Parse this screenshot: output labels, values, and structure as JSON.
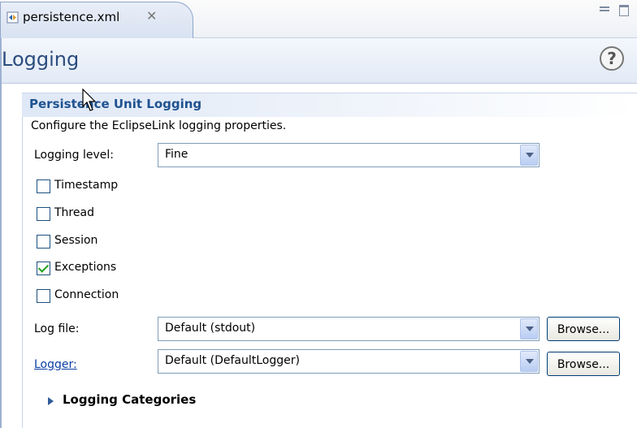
{
  "tab": {
    "title": "persistence.xml",
    "close_glyph": "✕"
  },
  "header": {
    "title": "Logging",
    "help_glyph": "?"
  },
  "section": {
    "title": "Persistence Unit Logging",
    "description": "Configure the EclipseLink logging properties."
  },
  "logging_level": {
    "label": "Logging level:",
    "value": "Fine"
  },
  "checkboxes": [
    {
      "label": "Timestamp",
      "checked": false
    },
    {
      "label": "Thread",
      "checked": false
    },
    {
      "label": "Session",
      "checked": false
    },
    {
      "label": "Exceptions",
      "checked": true
    },
    {
      "label": "Connection",
      "checked": false
    }
  ],
  "log_file": {
    "label": "Log file:",
    "value": "Default (stdout)",
    "browse": "Browse..."
  },
  "logger": {
    "label": "Logger:",
    "value": "Default (DefaultLogger)",
    "browse": "Browse..."
  },
  "categories": {
    "label": "Logging Categories"
  },
  "colors": {
    "accent": "#2b4c7e",
    "section_title": "#1f5290",
    "link": "#0b3fa3"
  }
}
